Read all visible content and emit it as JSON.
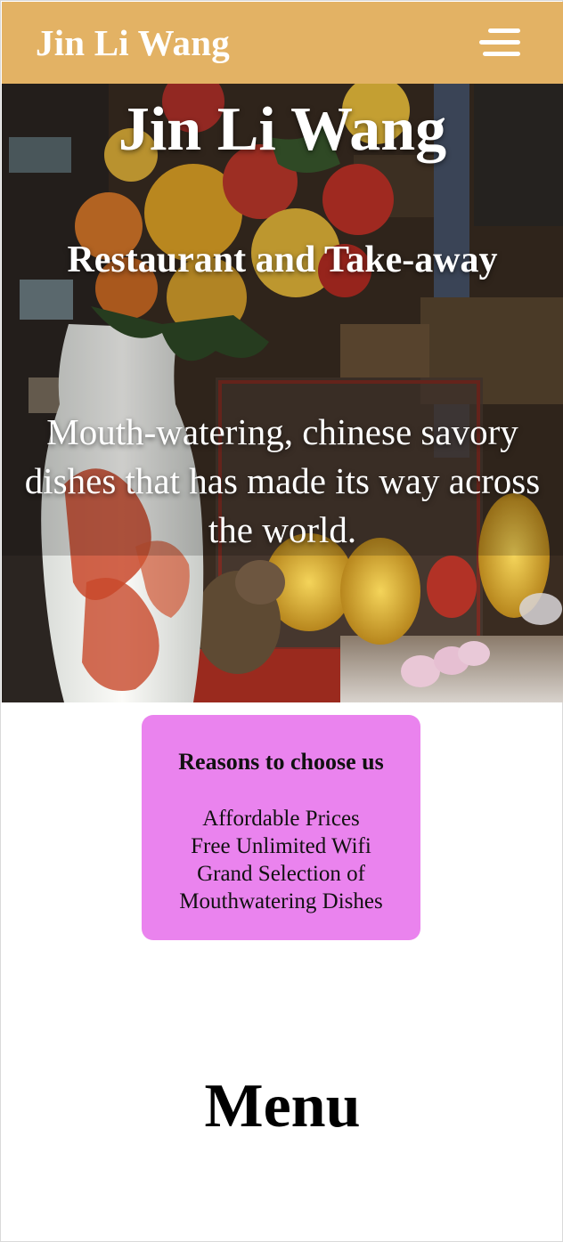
{
  "navbar": {
    "brand": "Jin Li Wang",
    "background_color": "#e3b264",
    "menu_icon": "hamburger-menu-icon"
  },
  "hero": {
    "title": "Jin Li Wang",
    "subtitle": "Restaurant and Take-away",
    "description": "Mouth-watering, chinese savory dishes that has made its way across the world."
  },
  "reasons": {
    "heading": "Reasons to choose us",
    "background_color": "#ea83ee",
    "items": [
      "Affordable Prices",
      "Free Unlimited Wifi",
      "Grand Selection of Mouthwatering Dishes"
    ]
  },
  "menu_section": {
    "heading": "Menu"
  }
}
